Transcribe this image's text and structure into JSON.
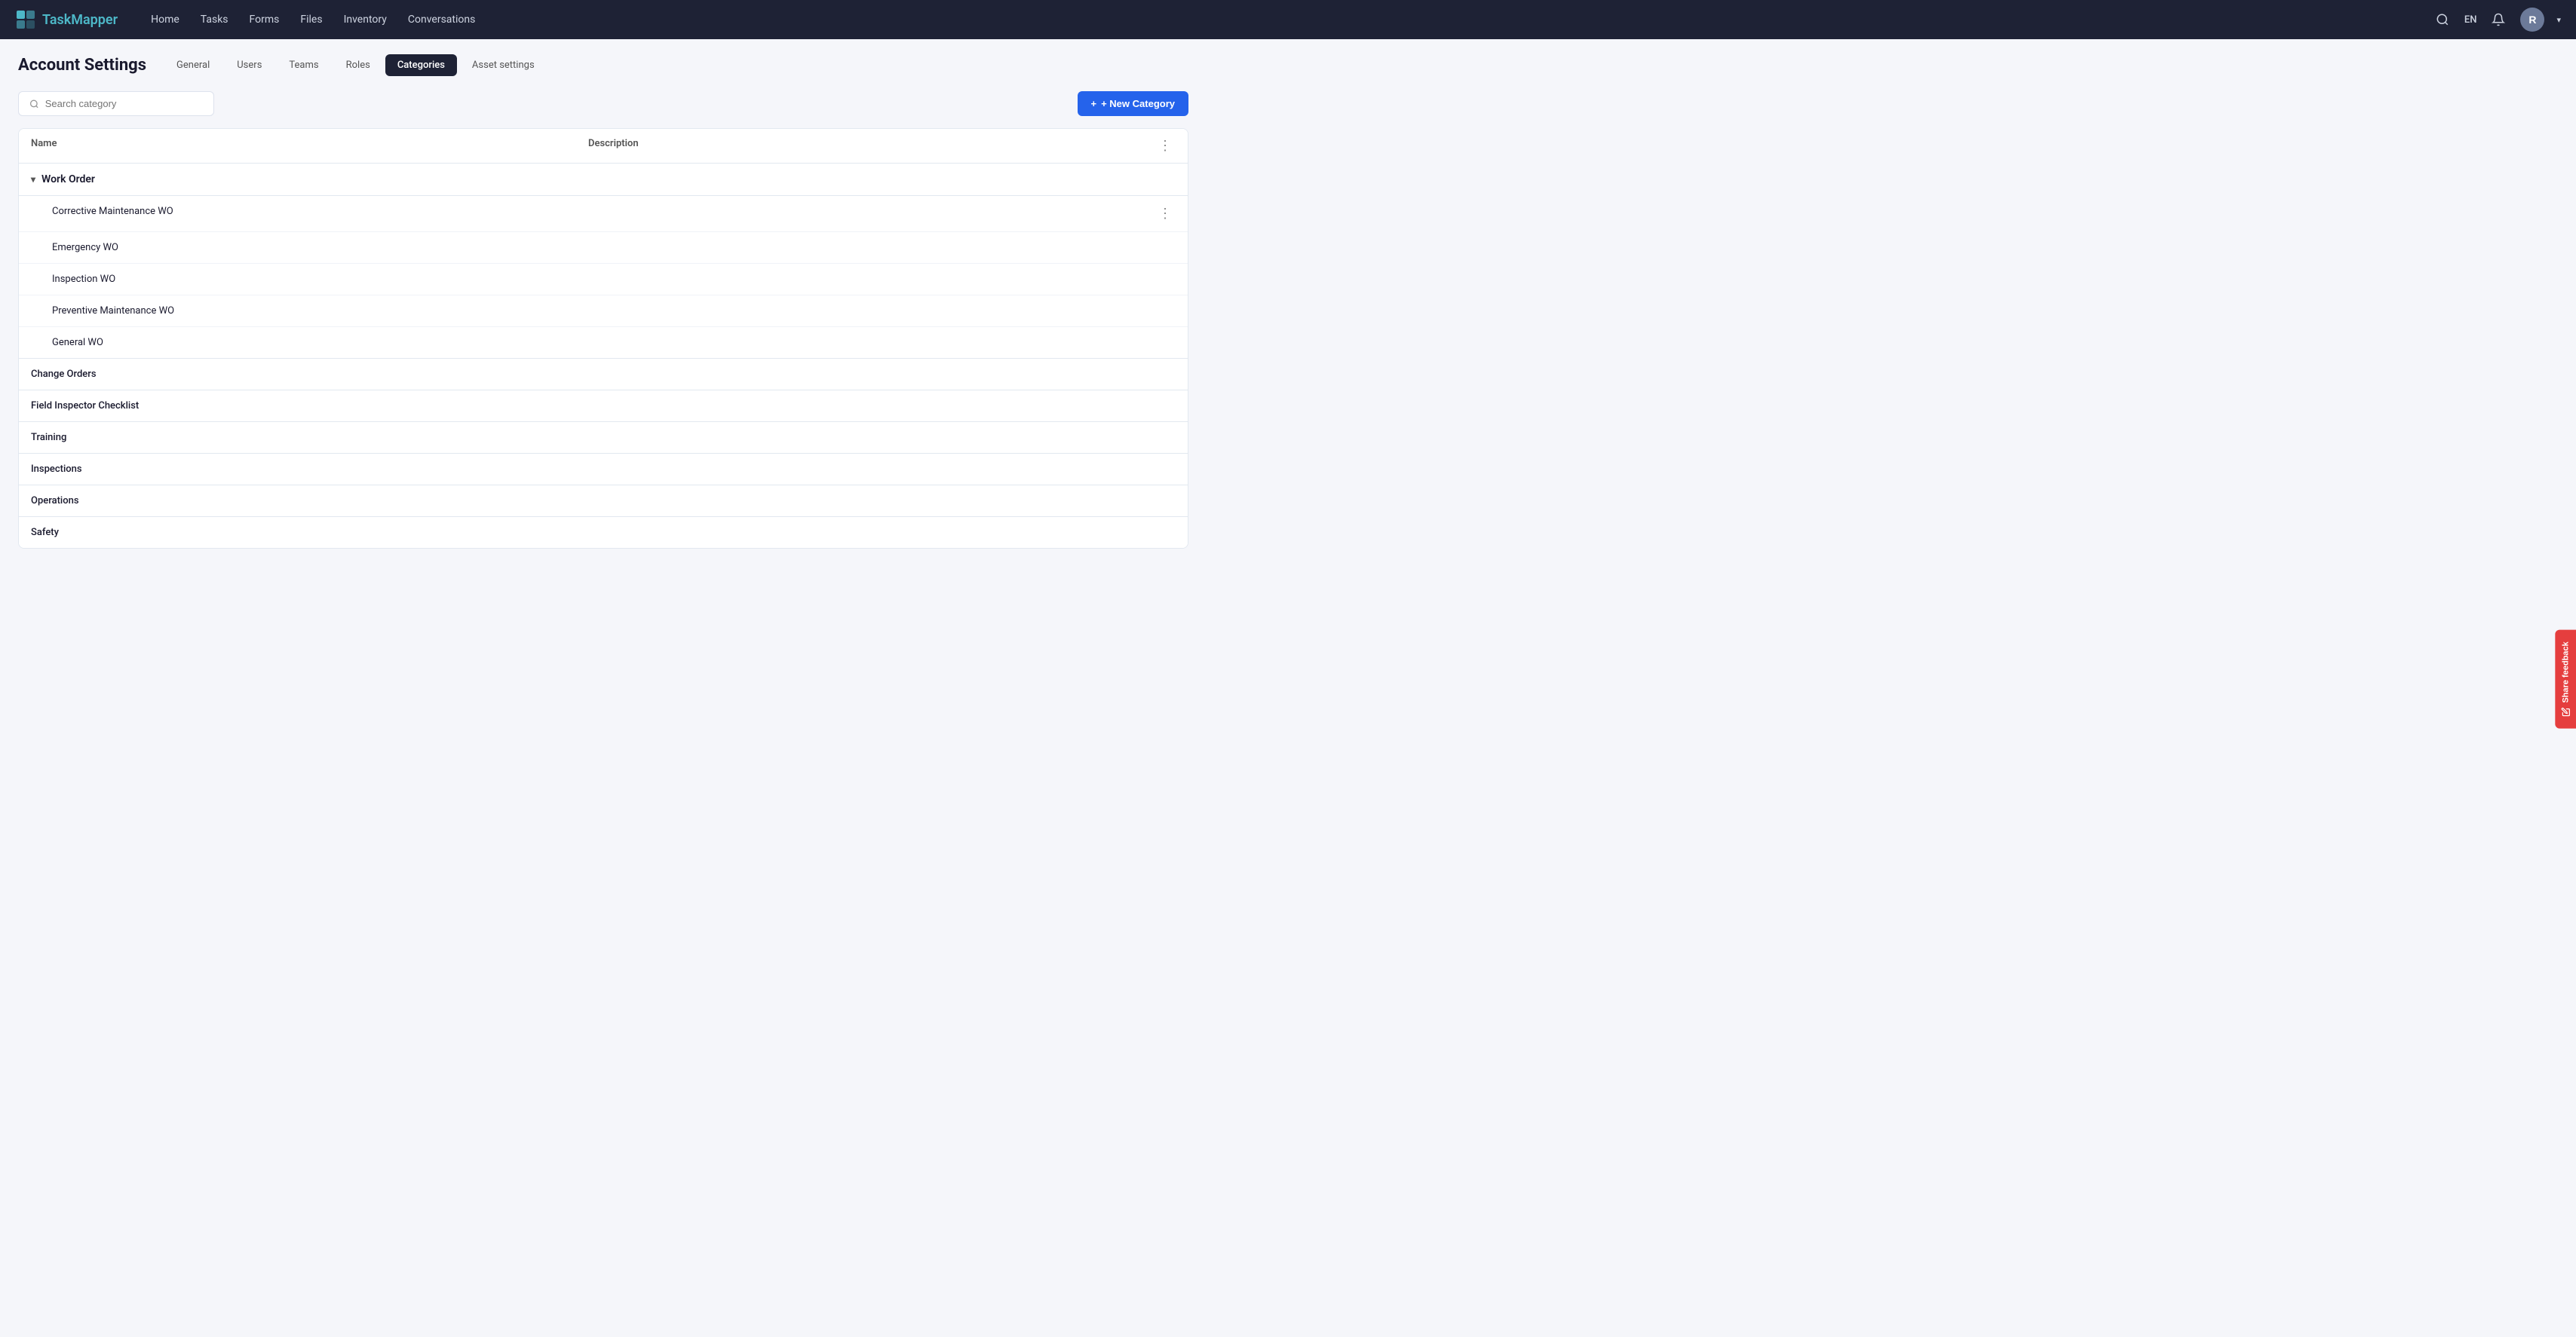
{
  "app": {
    "brand": "TaskMapper",
    "brand_part1": "Task",
    "brand_part2": "Mapper"
  },
  "navbar": {
    "links": [
      {
        "label": "Home",
        "id": "home"
      },
      {
        "label": "Tasks",
        "id": "tasks"
      },
      {
        "label": "Forms",
        "id": "forms"
      },
      {
        "label": "Files",
        "id": "files"
      },
      {
        "label": "Inventory",
        "id": "inventory"
      },
      {
        "label": "Conversations",
        "id": "conversations"
      }
    ],
    "lang": "EN",
    "avatar_initial": "R",
    "search_title": "Search"
  },
  "page": {
    "title": "Account Settings"
  },
  "tabs": [
    {
      "label": "General",
      "id": "general",
      "active": false
    },
    {
      "label": "Users",
      "id": "users",
      "active": false
    },
    {
      "label": "Teams",
      "id": "teams",
      "active": false
    },
    {
      "label": "Roles",
      "id": "roles",
      "active": false
    },
    {
      "label": "Categories",
      "id": "categories",
      "active": true
    },
    {
      "label": "Asset settings",
      "id": "asset-settings",
      "active": false
    }
  ],
  "toolbar": {
    "search_placeholder": "Search category",
    "new_category_label": "+ New Category"
  },
  "table": {
    "col_name": "Name",
    "col_description": "Description",
    "categories": [
      {
        "id": "work-order",
        "name": "Work Order",
        "expanded": true,
        "children": [
          {
            "name": "Corrective Maintenance WO",
            "description": ""
          },
          {
            "name": "Emergency WO",
            "description": ""
          },
          {
            "name": "Inspection WO",
            "description": ""
          },
          {
            "name": "Preventive Maintenance WO",
            "description": ""
          },
          {
            "name": "General WO",
            "description": ""
          }
        ]
      },
      {
        "id": "change-orders",
        "name": "Change Orders",
        "expanded": false,
        "children": []
      },
      {
        "id": "field-inspector",
        "name": "Field Inspector Checklist",
        "expanded": false,
        "children": []
      },
      {
        "id": "training",
        "name": "Training",
        "expanded": false,
        "children": []
      },
      {
        "id": "inspections",
        "name": "Inspections",
        "expanded": false,
        "children": []
      },
      {
        "id": "operations",
        "name": "Operations",
        "expanded": false,
        "children": []
      },
      {
        "id": "safety",
        "name": "Safety",
        "expanded": false,
        "children": []
      }
    ]
  },
  "feedback": {
    "label": "Share feedback"
  },
  "colors": {
    "accent": "#2563eb",
    "brand_teal": "#4db8c8",
    "navbar_bg": "#1e2235",
    "tab_active_bg": "#1e2235",
    "feedback_bg": "#e53e3e"
  }
}
